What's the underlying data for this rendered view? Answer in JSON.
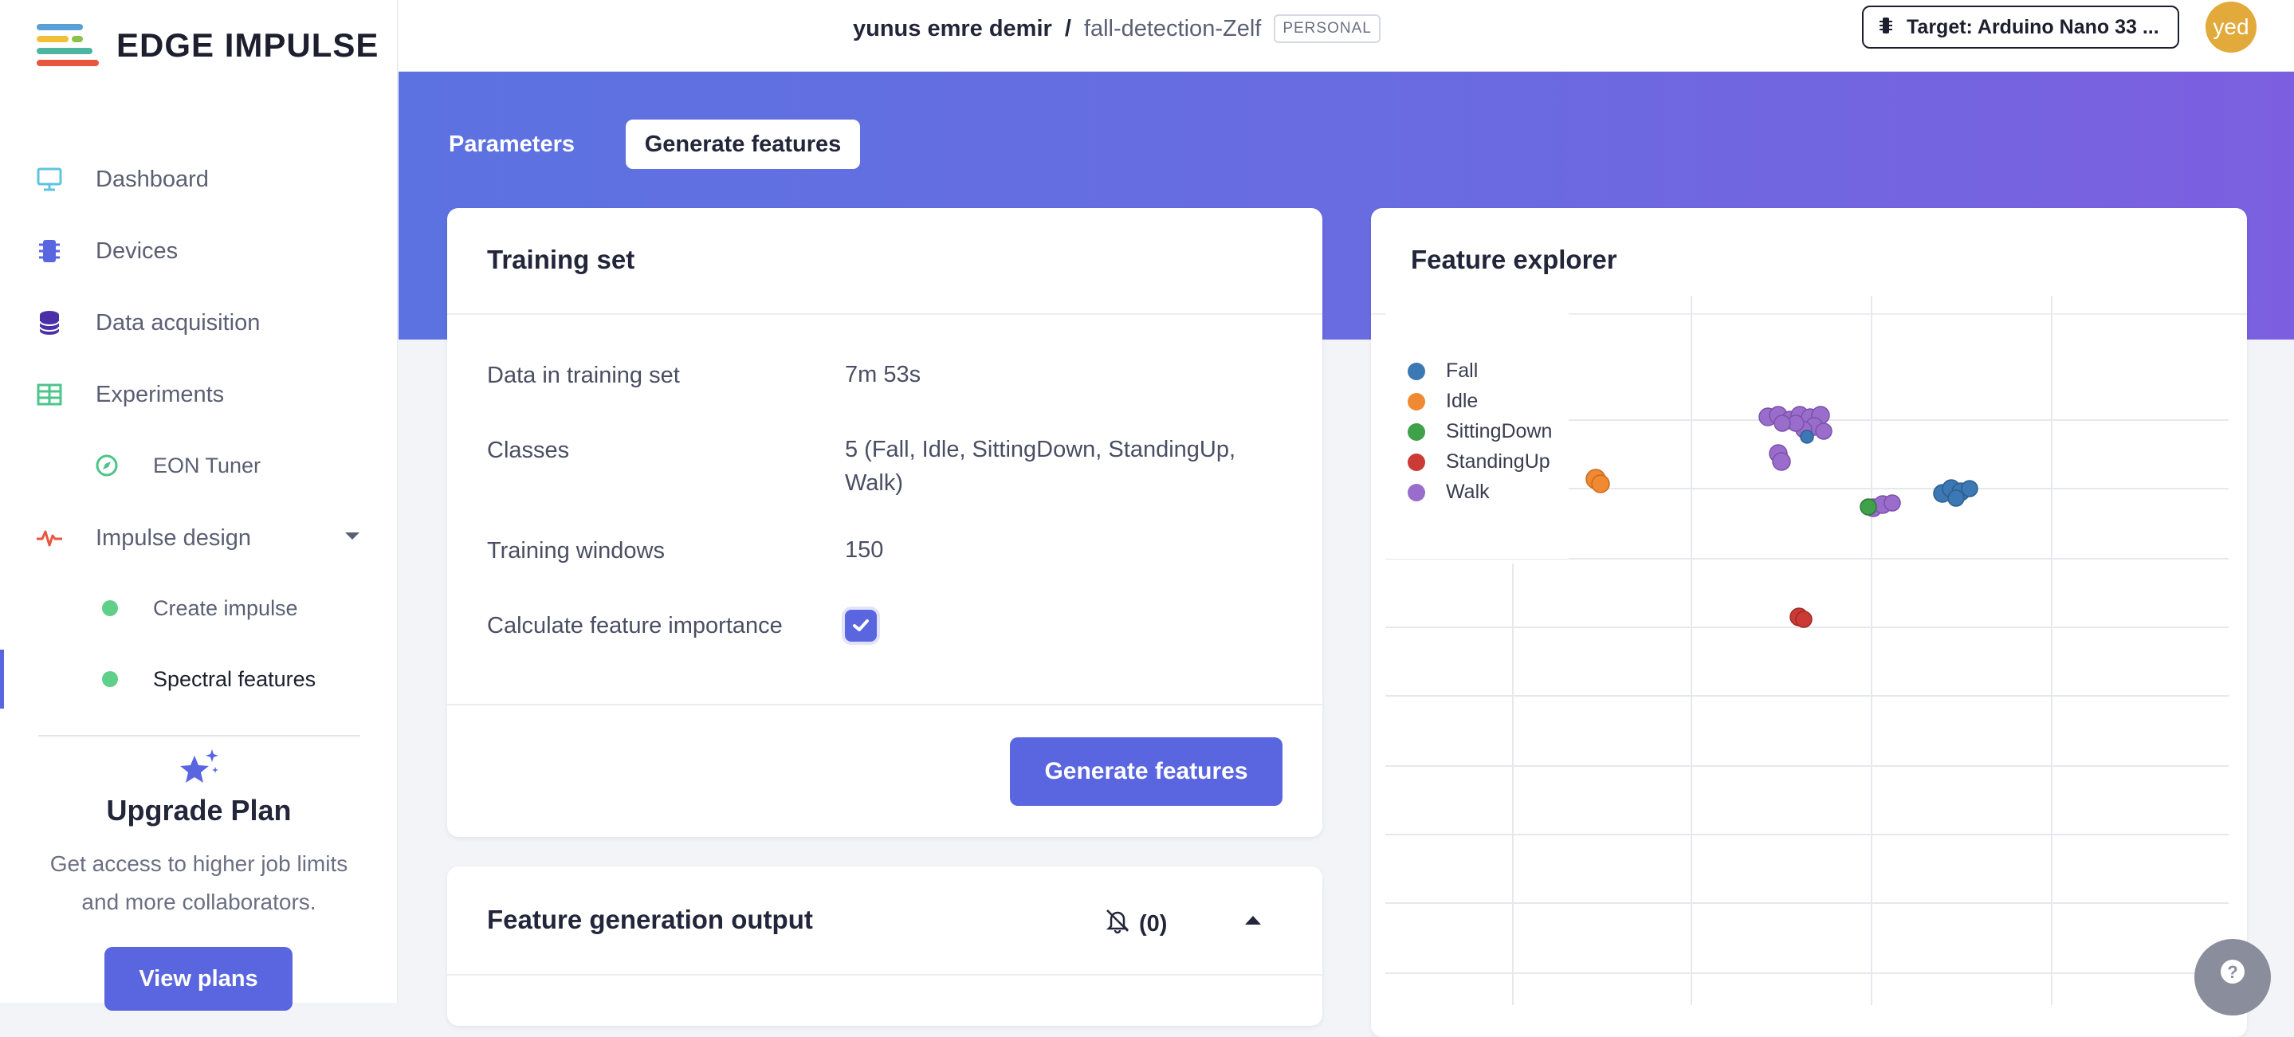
{
  "app": {
    "brand": "EDGE IMPULSE"
  },
  "sidebar": {
    "items": [
      {
        "label": "Dashboard",
        "icon": "monitor-icon"
      },
      {
        "label": "Devices",
        "icon": "chip-icon"
      },
      {
        "label": "Data acquisition",
        "icon": "database-icon"
      },
      {
        "label": "Experiments",
        "icon": "table-icon"
      },
      {
        "label": "EON Tuner",
        "icon": "compass-icon"
      },
      {
        "label": "Impulse design",
        "icon": "pulse-icon"
      },
      {
        "label": "Create impulse"
      },
      {
        "label": "Spectral features"
      }
    ],
    "upgrade": {
      "title": "Upgrade Plan",
      "text": "Get access to higher job limits and more collaborators.",
      "button": "View plans"
    }
  },
  "header": {
    "user": "yunus emre demir",
    "separator": "/",
    "project": "fall-detection-Zelf",
    "badge": "PERSONAL",
    "target": "Target: Arduino Nano 33 ...",
    "avatar": "yed"
  },
  "tabs": [
    {
      "label": "Parameters",
      "active": false
    },
    {
      "label": "Generate features",
      "active": true
    }
  ],
  "training_set": {
    "title": "Training set",
    "rows": [
      {
        "label": "Data in training set",
        "value": "7m 53s"
      },
      {
        "label": "Classes",
        "value": "5 (Fall, Idle, SittingDown, StandingUp, Walk)"
      },
      {
        "label": "Training windows",
        "value": "150"
      },
      {
        "label": "Calculate feature importance",
        "checked": true
      }
    ],
    "button": "Generate features"
  },
  "feature_output": {
    "title": "Feature generation output",
    "notifications": "(0)"
  },
  "feature_explorer": {
    "title": "Feature explorer",
    "legend": [
      {
        "name": "Fall",
        "color": "#3c78b4"
      },
      {
        "name": "Idle",
        "color": "#f08a32"
      },
      {
        "name": "SittingDown",
        "color": "#3fa14a"
      },
      {
        "name": "StandingUp",
        "color": "#cc3a36"
      },
      {
        "name": "Walk",
        "color": "#9a6ccb"
      }
    ]
  },
  "colors": {
    "accent": "#5a66e0",
    "banner_start": "#5c72e0",
    "banner_end": "#7c5fe0"
  }
}
